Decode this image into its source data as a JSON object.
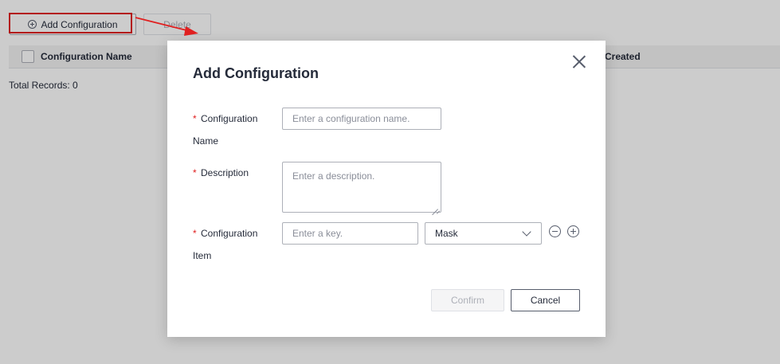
{
  "toolbar": {
    "add_label": "Add Configuration",
    "delete_label": "Delete"
  },
  "table": {
    "columns": [
      "Configuration Name",
      "Created"
    ]
  },
  "total_records": "Total Records: 0",
  "dialog": {
    "title": "Add Configuration",
    "required_mark": "*",
    "fields": [
      {
        "label_line1": "Configuration",
        "label_line2": "Name",
        "placeholder": "Enter a configuration name."
      },
      {
        "label_line1": "Description",
        "placeholder": "Enter a description."
      },
      {
        "label_line1": "Configuration",
        "label_line2": "Item",
        "key_placeholder": "Enter a key.",
        "select_value": "Mask"
      }
    ],
    "confirm_label": "Confirm",
    "cancel_label": "Cancel"
  },
  "colors": {
    "annotation": "#e02020",
    "required": "#e02020",
    "overlay": "rgba(0,0,0,0.2)"
  }
}
